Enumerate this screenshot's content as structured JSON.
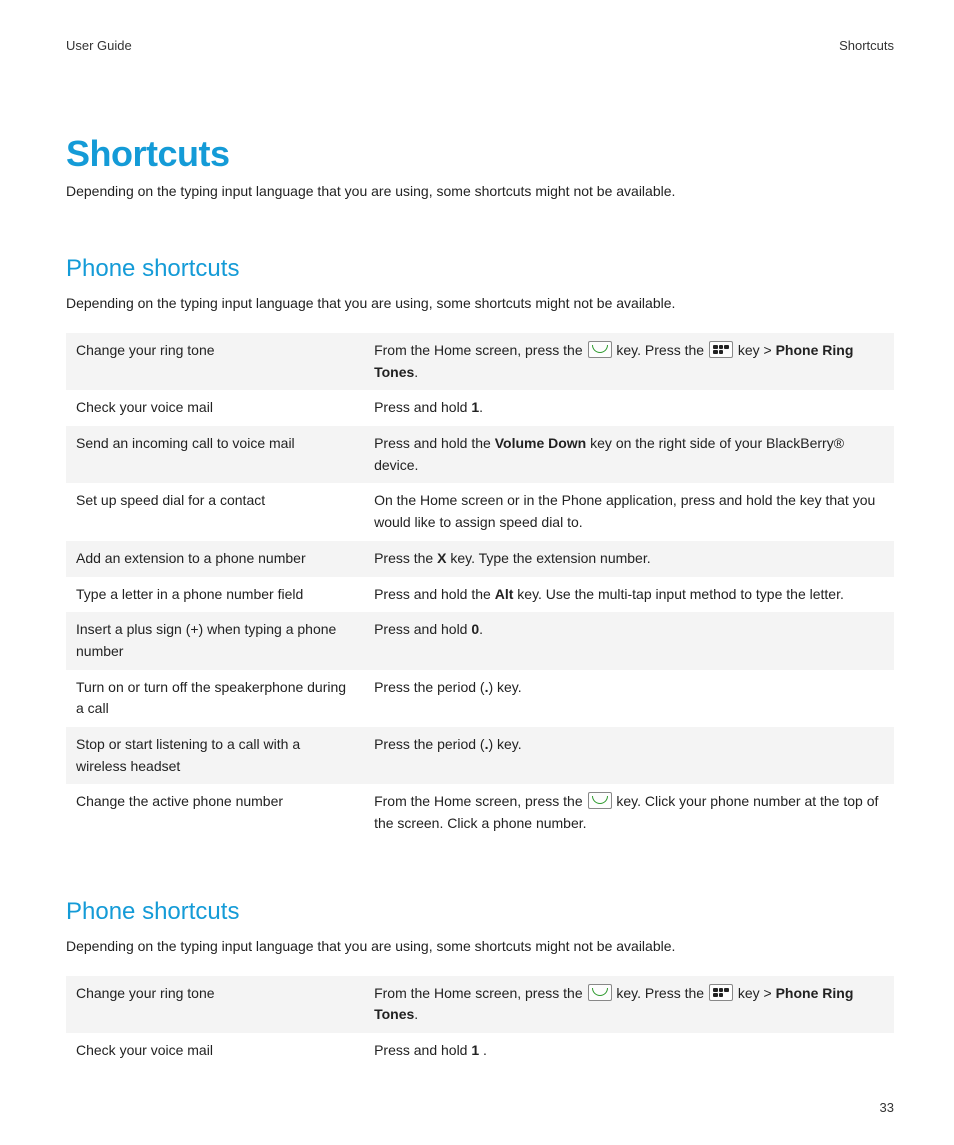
{
  "header": {
    "left": "User Guide",
    "right": "Shortcuts"
  },
  "title": "Shortcuts",
  "intro": "Depending on the typing input language that you are using, some shortcuts might not be available.",
  "sections": [
    {
      "heading": "Phone shortcuts",
      "intro": "Depending on the typing input language that you are using, some shortcuts might not be available.",
      "rows": [
        {
          "action": "Change your ring tone",
          "desc": [
            {
              "t": "text",
              "v": "From the Home screen, press the "
            },
            {
              "t": "icon",
              "v": "call"
            },
            {
              "t": "text",
              "v": " key. Press the "
            },
            {
              "t": "icon",
              "v": "menu"
            },
            {
              "t": "text",
              "v": " key > "
            },
            {
              "t": "bold",
              "v": "Phone Ring Tones"
            },
            {
              "t": "text",
              "v": "."
            }
          ]
        },
        {
          "action": "Check your voice mail",
          "desc": [
            {
              "t": "text",
              "v": "Press and hold "
            },
            {
              "t": "bold",
              "v": "1"
            },
            {
              "t": "text",
              "v": "."
            }
          ]
        },
        {
          "action": "Send an incoming call to voice mail",
          "desc": [
            {
              "t": "text",
              "v": "Press and hold the "
            },
            {
              "t": "bold",
              "v": "Volume Down"
            },
            {
              "t": "text",
              "v": " key on the right side of your BlackBerry® device."
            }
          ]
        },
        {
          "action": "Set up speed dial for a contact",
          "desc": [
            {
              "t": "text",
              "v": "On the Home screen or in the Phone application, press and hold the key that you would like to assign speed dial to."
            }
          ]
        },
        {
          "action": "Add an extension to a phone number",
          "desc": [
            {
              "t": "text",
              "v": "Press the "
            },
            {
              "t": "bold",
              "v": "X"
            },
            {
              "t": "text",
              "v": " key. Type the extension number."
            }
          ]
        },
        {
          "action": "Type a letter in a phone number field",
          "desc": [
            {
              "t": "text",
              "v": "Press and hold the "
            },
            {
              "t": "bold",
              "v": "Alt"
            },
            {
              "t": "text",
              "v": " key. Use the multi-tap input method to type the letter."
            }
          ]
        },
        {
          "action": "Insert a plus sign (+) when typing a phone number",
          "desc": [
            {
              "t": "text",
              "v": "Press and hold "
            },
            {
              "t": "bold",
              "v": "0"
            },
            {
              "t": "text",
              "v": "."
            }
          ]
        },
        {
          "action": "Turn on or turn off the speakerphone during a call",
          "desc": [
            {
              "t": "text",
              "v": "Press the period ("
            },
            {
              "t": "bold",
              "v": "."
            },
            {
              "t": "text",
              "v": ") key."
            }
          ]
        },
        {
          "action": "Stop or start listening to a call with a wireless headset",
          "desc": [
            {
              "t": "text",
              "v": "Press the period ("
            },
            {
              "t": "bold",
              "v": "."
            },
            {
              "t": "text",
              "v": ") key."
            }
          ]
        },
        {
          "action": "Change the active phone number",
          "desc": [
            {
              "t": "text",
              "v": "From the Home screen, press the "
            },
            {
              "t": "icon",
              "v": "call"
            },
            {
              "t": "text",
              "v": " key. Click your phone number at the top of the screen. Click a phone number."
            }
          ]
        }
      ]
    },
    {
      "heading": "Phone shortcuts",
      "intro": "Depending on the typing input language that you are using, some shortcuts might not be available.",
      "rows": [
        {
          "action": "Change your ring tone",
          "desc": [
            {
              "t": "text",
              "v": "From the Home screen, press the "
            },
            {
              "t": "icon",
              "v": "call"
            },
            {
              "t": "text",
              "v": " key. Press the "
            },
            {
              "t": "icon",
              "v": "menu"
            },
            {
              "t": "text",
              "v": " key > "
            },
            {
              "t": "bold",
              "v": "Phone Ring Tones"
            },
            {
              "t": "text",
              "v": "."
            }
          ]
        },
        {
          "action": "Check your voice mail",
          "desc": [
            {
              "t": "text",
              "v": "Press and hold "
            },
            {
              "t": "bold",
              "v": "1"
            },
            {
              "t": "text",
              "v": " ."
            }
          ]
        }
      ]
    }
  ],
  "page_number": "33"
}
